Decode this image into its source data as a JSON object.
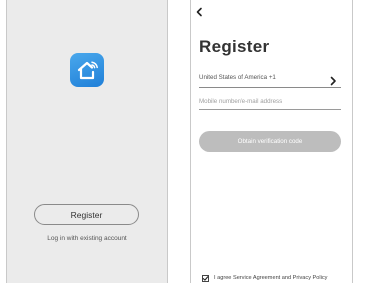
{
  "welcome": {
    "logo_icon": "smart-home-wifi-icon",
    "register_label": "Register",
    "login_link": "Log in with existing account"
  },
  "register": {
    "back_icon": "chevron-left-icon",
    "title": "Register",
    "country_value": "United States of America +1",
    "country_chevron_icon": "chevron-right-icon",
    "account_placeholder": "Mobile number/e-mail address",
    "obtain_label": "Obtain verification code",
    "agree_text": "I agree Service Agreement and Privacy Policy",
    "agree_checked": true
  },
  "colors": {
    "logo_gradient_start": "#4aa8ec",
    "logo_gradient_end": "#1f7fd8",
    "disabled_button": "#bdbdbd",
    "left_background": "#ebebeb"
  }
}
